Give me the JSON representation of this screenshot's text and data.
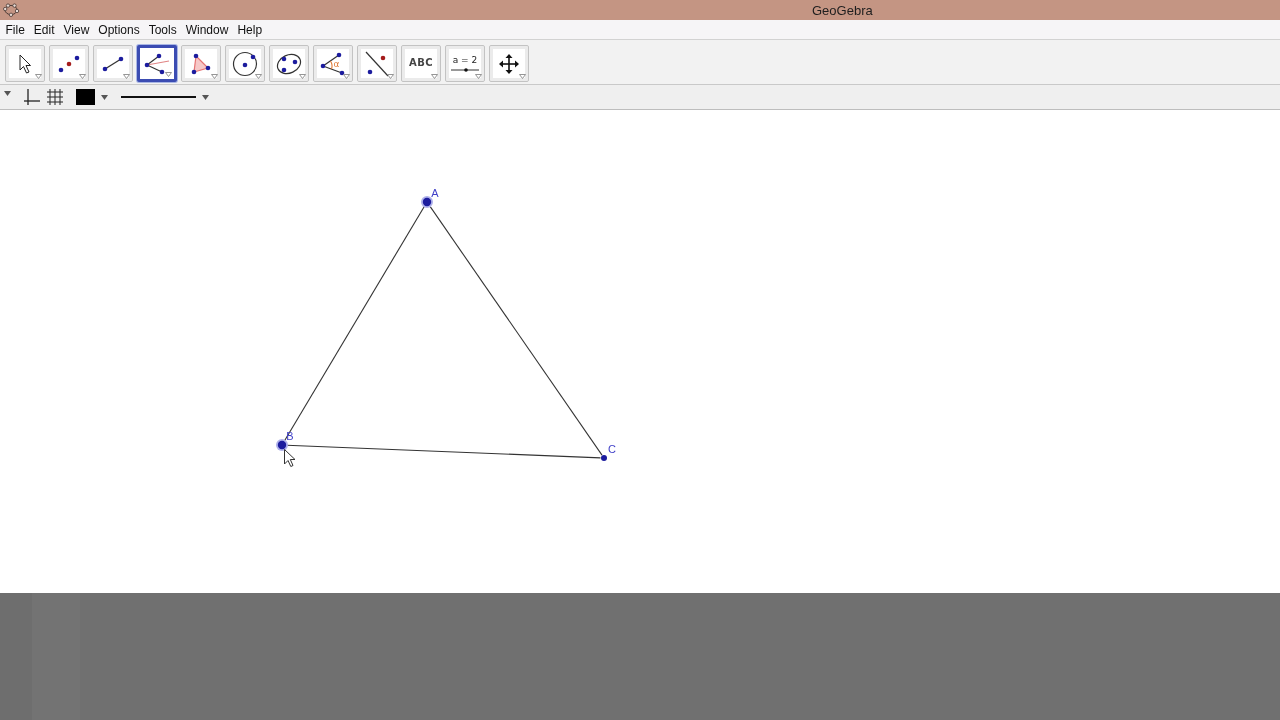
{
  "window": {
    "title": "GeoGebra"
  },
  "menu": [
    "File",
    "Edit",
    "View",
    "Options",
    "Tools",
    "Window",
    "Help"
  ],
  "toolbar": [
    {
      "kind": "move",
      "selected": false
    },
    {
      "kind": "point",
      "selected": false
    },
    {
      "kind": "segment",
      "selected": false
    },
    {
      "kind": "perpendicular",
      "selected": true
    },
    {
      "kind": "polygon",
      "selected": false
    },
    {
      "kind": "circle",
      "selected": false
    },
    {
      "kind": "conic",
      "selected": false
    },
    {
      "kind": "angle",
      "selected": false,
      "label": "α"
    },
    {
      "kind": "reflect",
      "selected": false
    },
    {
      "kind": "text",
      "selected": false,
      "label": "ABC"
    },
    {
      "kind": "slider",
      "selected": false,
      "label": "a = 2"
    },
    {
      "kind": "move_view",
      "selected": false
    }
  ],
  "style_bar": {
    "toggles": [
      {
        "kind": "axes",
        "on": false
      },
      {
        "kind": "grid",
        "on": false
      }
    ],
    "color": "#000000"
  },
  "canvas": {
    "points": [
      {
        "label": "A",
        "selected": true
      },
      {
        "label": "B",
        "selected": true
      },
      {
        "label": "C",
        "selected": false
      }
    ]
  }
}
